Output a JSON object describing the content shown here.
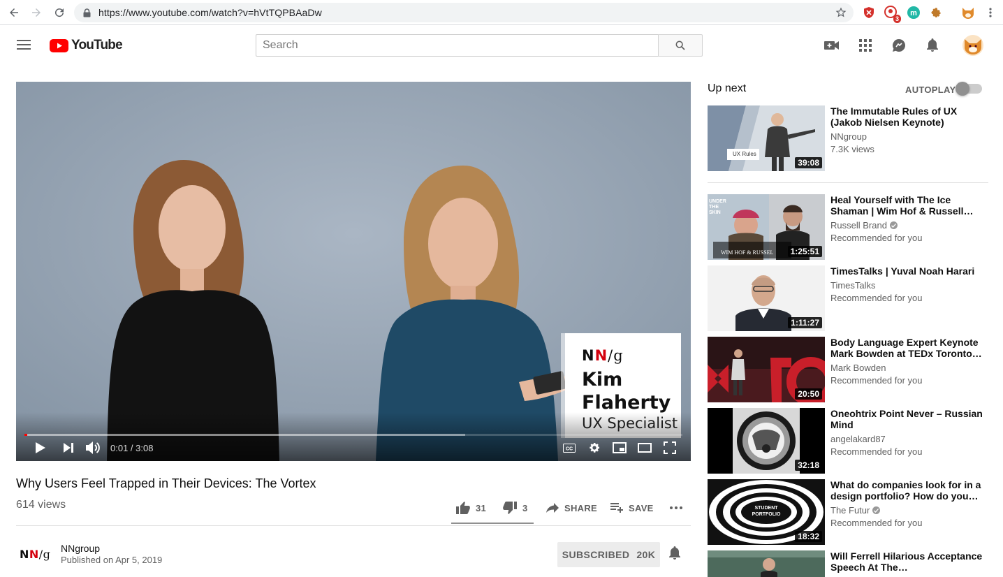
{
  "browser": {
    "url": "https://www.youtube.com/watch?v=hVtTQPBAaDw",
    "extension_badge": "3"
  },
  "header": {
    "logo_text": "YouTube",
    "search_placeholder": "Search"
  },
  "player": {
    "lower_third": {
      "logo_n1": "N",
      "logo_n2": "N",
      "logo_slash_g": "/g",
      "name_line1": "Kim",
      "name_line2": "Flaherty",
      "role": "UX Specialist"
    },
    "time": "0:01 / 3:08",
    "progress_played_fraction": 0.004,
    "progress_loaded_fraction": 0.67
  },
  "video": {
    "title": "Why Users Feel Trapped in Their Devices: The Vortex",
    "views": "614 views",
    "likes": "31",
    "dislikes": "3",
    "share_label": "SHARE",
    "save_label": "SAVE"
  },
  "channel": {
    "logo_n1": "N",
    "logo_n2": "N",
    "logo_slash_g": "/g",
    "name": "NNgroup",
    "published": "Published on Apr 5, 2019",
    "subscribed_label": "SUBSCRIBED",
    "subscriber_count": "20K"
  },
  "sidebar": {
    "up_next_label": "Up next",
    "autoplay_label": "AUTOPLAY",
    "autoplay_on": false,
    "videos": [
      {
        "title": "The Immutable Rules of UX (Jakob Nielsen Keynote)",
        "channel": "NNgroup",
        "meta": "7.3K views",
        "duration": "39:08",
        "thumb_text": "UX Rules",
        "verified": false
      },
      {
        "title": "Heal Yourself with The Ice Shaman | Wim Hof & Russell…",
        "channel": "Russell Brand",
        "meta": "Recommended for you",
        "duration": "1:25:51",
        "thumb_text": "UNDER THE SKIN",
        "thumb_sub": "WIM HOF & RUSSEL",
        "verified": true
      },
      {
        "title": "TimesTalks | Yuval Noah Harari",
        "channel": "TimesTalks",
        "meta": "Recommended for you",
        "duration": "1:11:27",
        "verified": false
      },
      {
        "title": "Body Language Expert Keynote Mark Bowden at TEDx Toronto…",
        "channel": "Mark Bowden",
        "meta": "Recommended for you",
        "duration": "20:50",
        "verified": false
      },
      {
        "title": "Oneohtrix Point Never – Russian Mind",
        "channel": "angelakard87",
        "meta": "Recommended for you",
        "duration": "32:18",
        "verified": false
      },
      {
        "title": "What do companies look for in a design portfolio? How do you…",
        "channel": "The Futur",
        "meta": "Recommended for you",
        "duration": "18:32",
        "thumb_text": "STUDENT PORTFOLIO",
        "verified": true
      },
      {
        "title": "Will Ferrell Hilarious Acceptance Speech At The…",
        "channel": "",
        "meta": "",
        "duration": "",
        "verified": false
      }
    ]
  },
  "colors": {
    "youtube_red": "#ff0000",
    "nng_red": "#d4000d",
    "text_secondary": "#606060"
  }
}
